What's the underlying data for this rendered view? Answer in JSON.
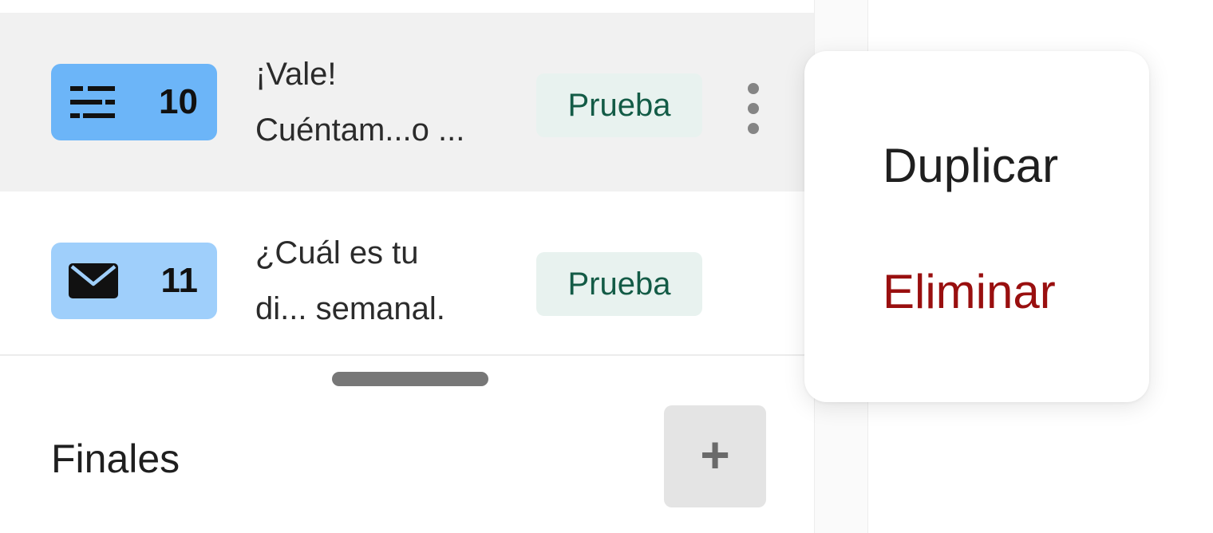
{
  "list": {
    "rows": [
      {
        "type_icon": "short-text-icon",
        "number": "10",
        "text_line1": "¡Vale!",
        "text_line2": "Cuéntam...o ...",
        "tag": "Prueba",
        "badge_color": "#6cb5f8"
      },
      {
        "type_icon": "envelope-icon",
        "number": "11",
        "text_line1": "¿Cuál es tu",
        "text_line2": "di... semanal.",
        "tag": "Prueba",
        "badge_color": "#9fcffb"
      }
    ]
  },
  "section": {
    "title": "Finales",
    "add_label": "+"
  },
  "context_menu": {
    "items": [
      {
        "label": "Duplicar",
        "color": "#1f1f1f"
      },
      {
        "label": "Eliminar",
        "color": "#990f0f"
      }
    ]
  },
  "colors": {
    "tag_bg": "#e8f2ef",
    "tag_text": "#135b46",
    "selected_row_bg": "#f1f1f1"
  }
}
